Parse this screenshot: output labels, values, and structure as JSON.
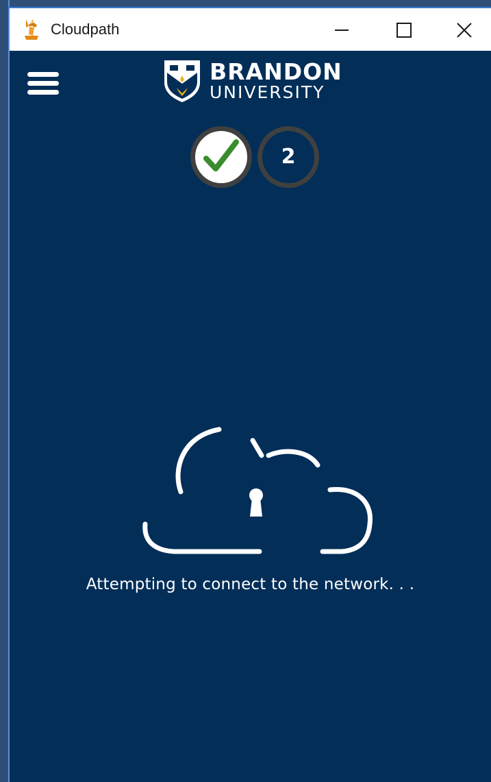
{
  "window": {
    "title": "Cloudpath",
    "icon": "cloudpath-app-icon"
  },
  "controls": {
    "minimize_icon": "minimize-icon",
    "maximize_icon": "maximize-icon",
    "close_icon": "close-icon"
  },
  "header": {
    "menu_icon": "hamburger-menu-icon",
    "logo": {
      "line1": "BRANDON",
      "line2": "UNIVERSITY"
    }
  },
  "progress": {
    "steps": [
      {
        "state": "complete",
        "icon": "checkmark-icon"
      },
      {
        "state": "current",
        "label": "2"
      }
    ]
  },
  "main": {
    "illustration": "cloud-lock-icon",
    "status": "Attempting to connect to the network. . ."
  },
  "colors": {
    "background": "#022e58",
    "step_border": "#404040",
    "check": "#3a8c2e",
    "logo_gold": "#e8b020"
  }
}
